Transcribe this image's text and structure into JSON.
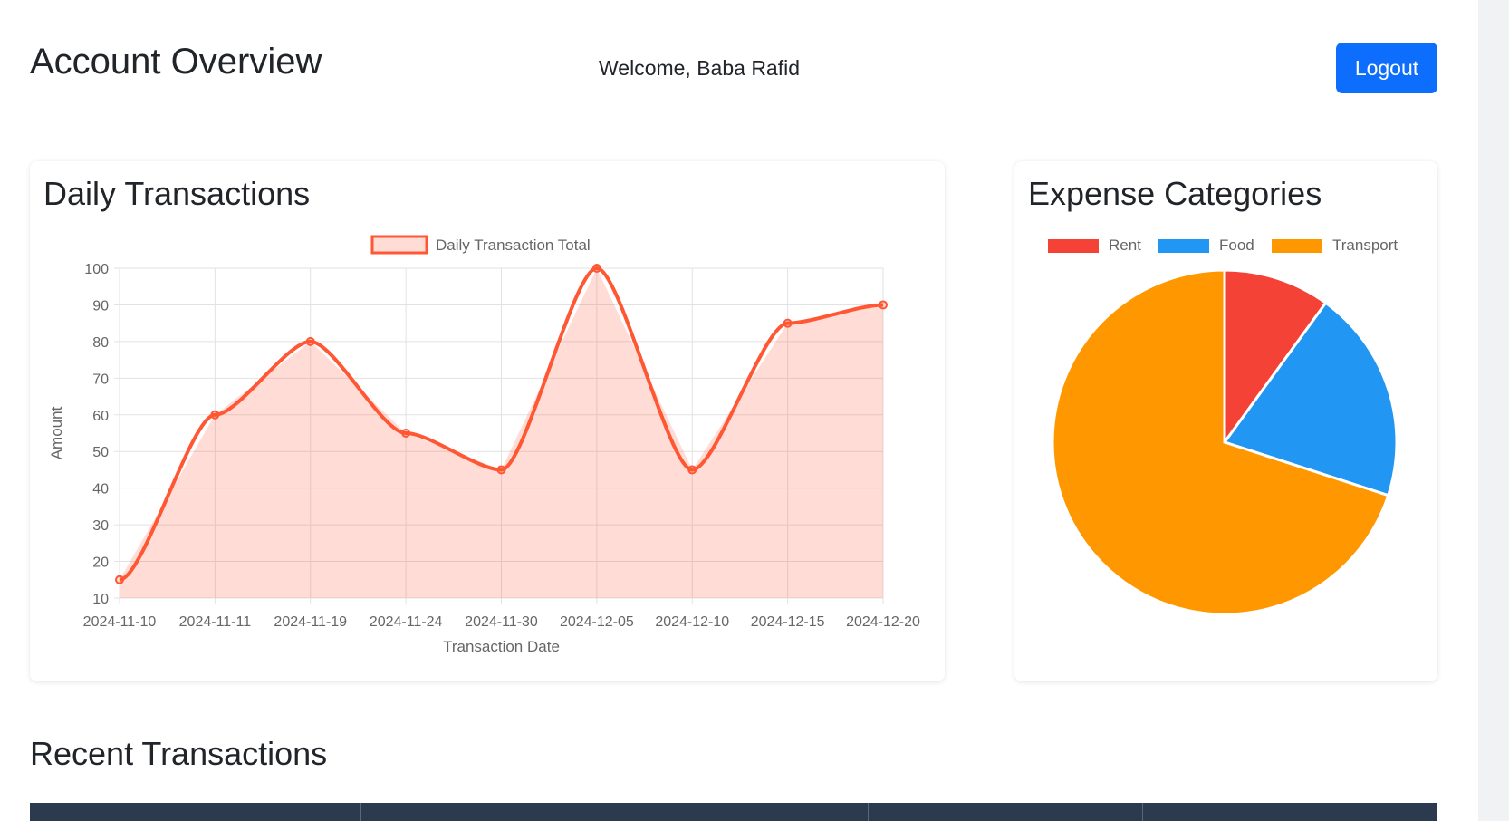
{
  "header": {
    "title": "Account Overview",
    "welcome": "Welcome, Baba Rafid",
    "logout_label": "Logout"
  },
  "colors": {
    "primary": "#0d6efd",
    "line": "#ff5733",
    "line_fill": "rgba(255,87,51,0.2)",
    "table_header": "#2b3a4e"
  },
  "line_card": {
    "title": "Daily Transactions"
  },
  "pie_card": {
    "title": "Expense Categories"
  },
  "recent": {
    "title": "Recent Transactions",
    "columns": [
      "",
      "",
      "",
      ""
    ]
  },
  "chart_data": [
    {
      "type": "line",
      "title": "Daily Transactions",
      "x": [
        "2024-11-10",
        "2024-11-11",
        "2024-11-19",
        "2024-11-24",
        "2024-11-30",
        "2024-12-05",
        "2024-12-10",
        "2024-12-15",
        "2024-12-20"
      ],
      "series": [
        {
          "name": "Daily Transaction Total",
          "values": [
            15,
            60,
            80,
            55,
            45,
            100,
            45,
            85,
            90
          ],
          "color": "#ff5733"
        }
      ],
      "xlabel": "Transaction Date",
      "ylabel": "Amount",
      "ylim": [
        10,
        100
      ],
      "yticks": [
        10,
        20,
        30,
        40,
        50,
        60,
        70,
        80,
        90,
        100
      ],
      "grid": true,
      "fill": true,
      "legend": "top"
    },
    {
      "type": "pie",
      "title": "Expense Categories",
      "categories": [
        "Rent",
        "Food",
        "Transport"
      ],
      "values": [
        10,
        20,
        70
      ],
      "colors": [
        "#f44336",
        "#2196f3",
        "#ff9800"
      ],
      "legend": "top"
    }
  ]
}
